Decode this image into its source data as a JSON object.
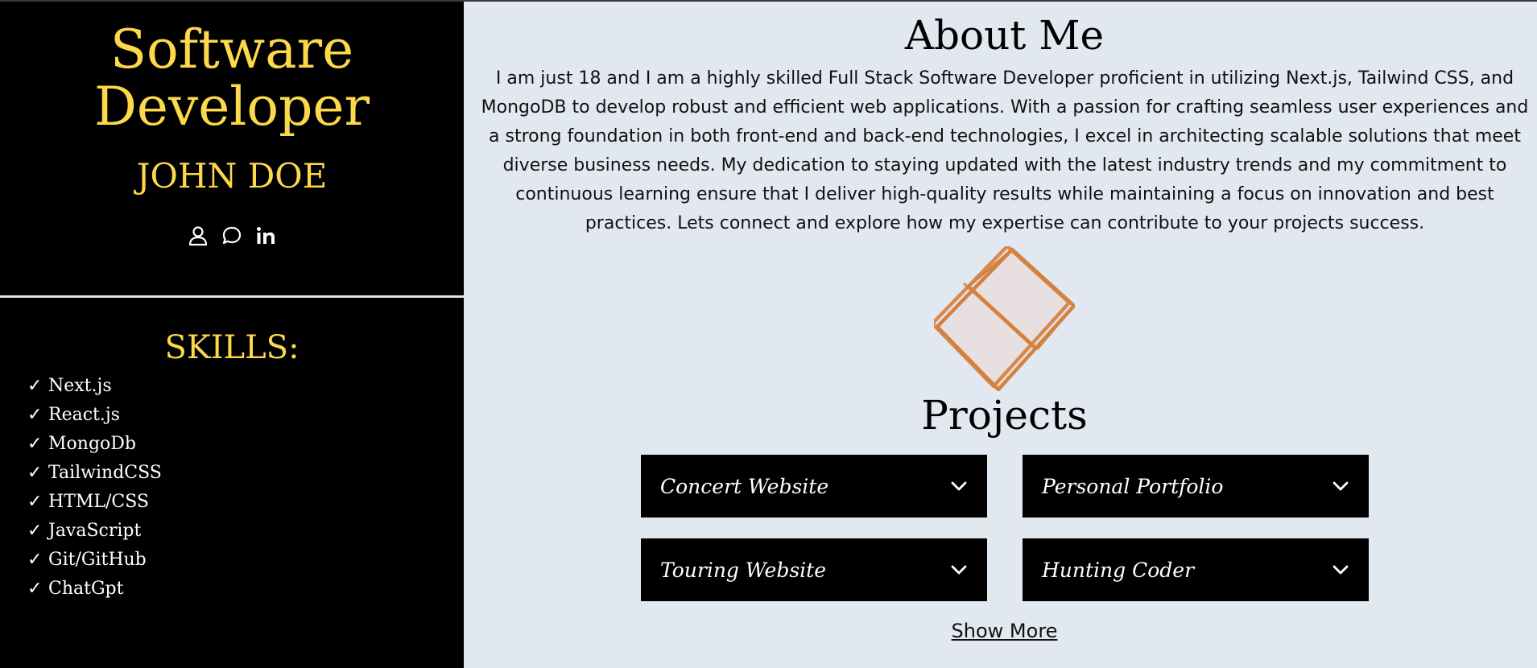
{
  "profile": {
    "title_line1": "Software",
    "title_line2": "Developer",
    "name": "JOHN DOE",
    "social_icons": [
      "user-icon",
      "chat-bubble-icon",
      "linkedin-icon"
    ]
  },
  "skills": {
    "title": "SKILLS:",
    "check_symbol": "✓",
    "items": [
      "Next.js",
      "React.js",
      "MongoDb",
      "TailwindCSS",
      "HTML/CSS",
      "JavaScript",
      "Git/GitHub",
      "ChatGpt"
    ]
  },
  "about": {
    "title": "About Me",
    "line1": "I am just 18 and I am a highly skilled Full Stack Software Developer proficient in utilizing Next.js, Tailwind CSS, and",
    "line2": "MongoDB to develop robust and efficient web applications. With a passion for crafting seamless user experiences and",
    "line3": "a strong foundation in both front-end and back-end technologies, I excel in architecting scalable solutions that meet",
    "line4": "diverse business needs. My dedication to staying updated with the latest industry trends and my commitment to",
    "line5": "continuous learning ensure that I deliver high-quality results while maintaining a focus on innovation and best",
    "line6": "practices. Lets connect and explore how my expertise can contribute to your projects success."
  },
  "projects": {
    "title": "Projects",
    "items": [
      {
        "title": "Concert Website"
      },
      {
        "title": "Personal Portfolio"
      },
      {
        "title": "Touring Website"
      },
      {
        "title": "Hunting Coder"
      }
    ],
    "show_more": "Show More"
  },
  "colors": {
    "sidebar_bg": "#000000",
    "accent": "#fcd94a",
    "main_bg": "#e2e8f0",
    "cube_stroke": "#d4813f",
    "cube_fill": "#e8e0e0"
  }
}
